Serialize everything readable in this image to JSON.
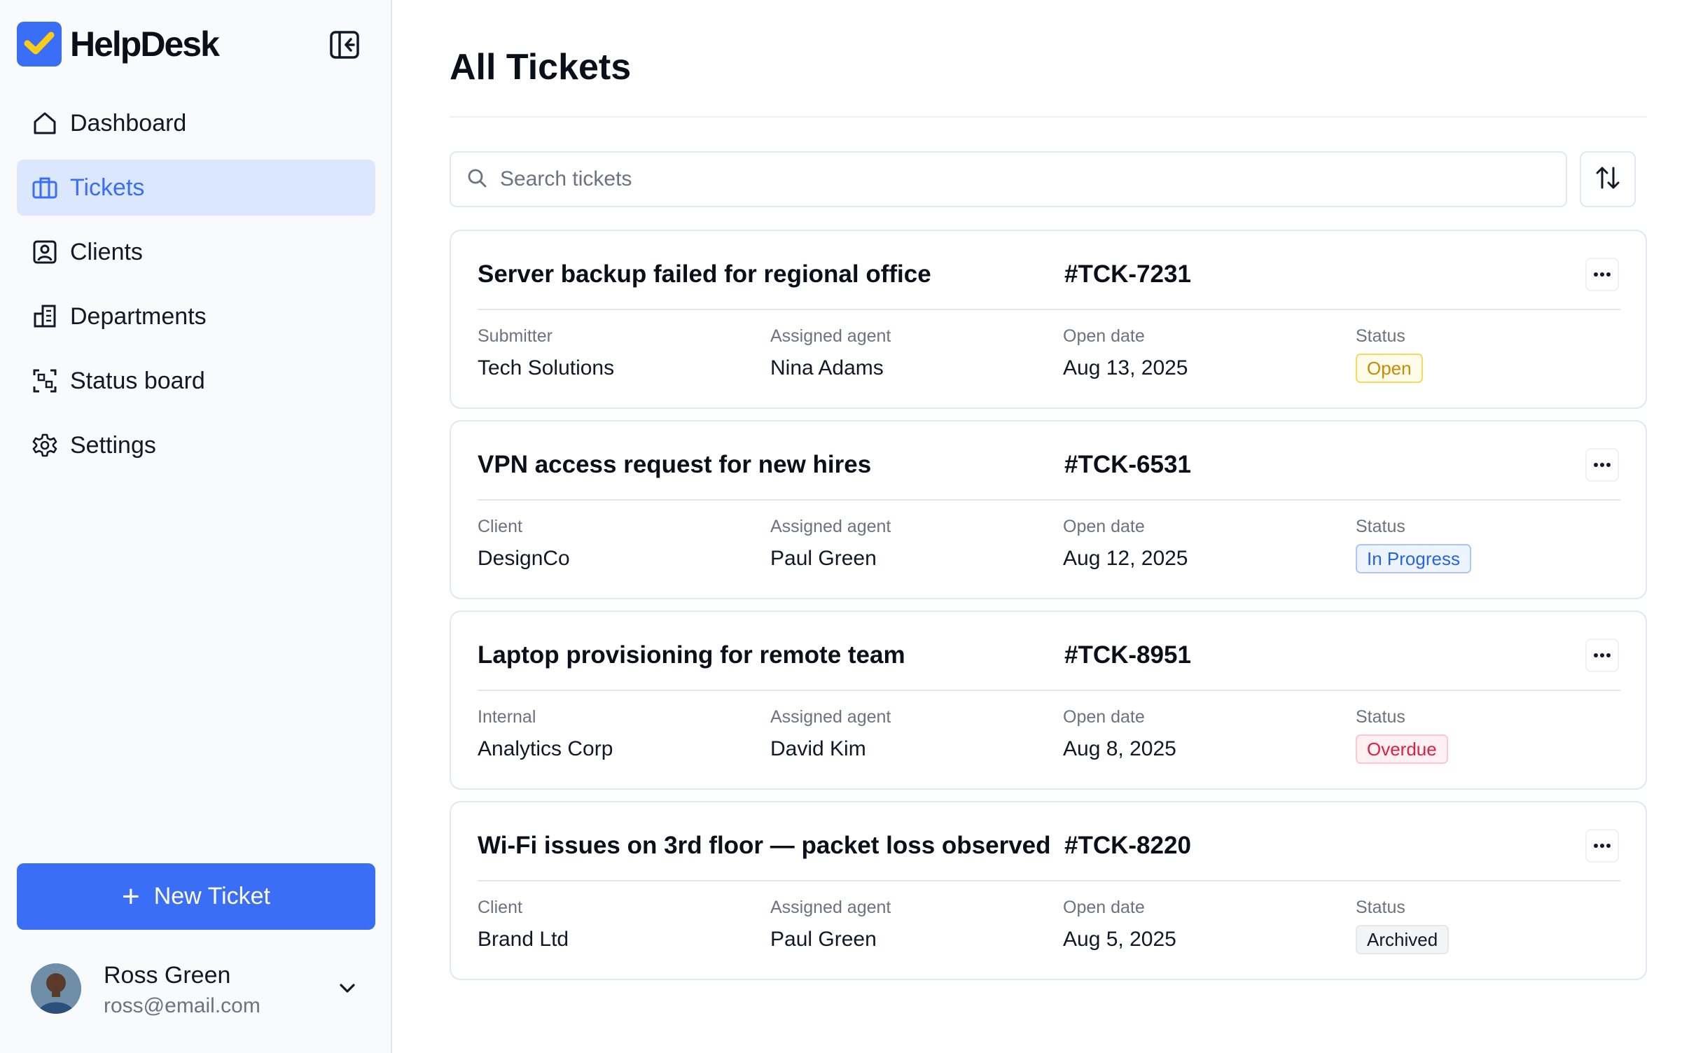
{
  "sidebar": {
    "brand": "HelpDesk",
    "nav": [
      {
        "label": "Dashboard",
        "icon": "home-icon"
      },
      {
        "label": "Tickets",
        "icon": "ticket-icon",
        "active": true
      },
      {
        "label": "Clients",
        "icon": "client-icon"
      },
      {
        "label": "Departments",
        "icon": "building-icon"
      },
      {
        "label": "Status board",
        "icon": "board-icon"
      },
      {
        "label": "Settings",
        "icon": "gear-icon"
      }
    ],
    "new_ticket_label": "New Ticket",
    "user": {
      "name": "Ross Green",
      "email": "ross@email.com"
    }
  },
  "main": {
    "title": "All Tickets",
    "search_placeholder": "Search tickets",
    "tickets": [
      {
        "title": "Server backup failed for regional office",
        "id": "#TCK-7231",
        "fields": [
          {
            "label": "Submitter",
            "value": "Tech Solutions"
          },
          {
            "label": "Assigned agent",
            "value": "Nina Adams"
          },
          {
            "label": "Open date",
            "value": "Aug 13, 2025"
          }
        ],
        "status_label": "Status",
        "status": "Open"
      },
      {
        "title": "VPN access request for new hires",
        "id": "#TCK-6531",
        "fields": [
          {
            "label": "Client",
            "value": "DesignCo"
          },
          {
            "label": "Assigned agent",
            "value": "Paul Green"
          },
          {
            "label": "Open date",
            "value": "Aug 12, 2025"
          }
        ],
        "status_label": "Status",
        "status": "In Progress"
      },
      {
        "title": "Laptop provisioning for remote team",
        "id": "#TCK-8951",
        "fields": [
          {
            "label": "Internal",
            "value": "Analytics Corp"
          },
          {
            "label": "Assigned agent",
            "value": "David Kim"
          },
          {
            "label": "Open date",
            "value": "Aug 8, 2025"
          }
        ],
        "status_label": "Status",
        "status": "Overdue"
      },
      {
        "title": "Wi-Fi issues on 3rd floor — packet loss observed",
        "id": "#TCK-8220",
        "fields": [
          {
            "label": "Client",
            "value": "Brand Ltd"
          },
          {
            "label": "Assigned agent",
            "value": "Paul Green"
          },
          {
            "label": "Open date",
            "value": "Aug 5, 2025"
          }
        ],
        "status_label": "Status",
        "status": "Archived"
      }
    ]
  },
  "colors": {
    "accent": "#3b6ef6",
    "active_nav_bg": "#dbe7fe",
    "status_open": "#ca8a04",
    "status_in_progress": "#2563eb",
    "status_overdue": "#e11d48",
    "status_archived": "#111827"
  }
}
